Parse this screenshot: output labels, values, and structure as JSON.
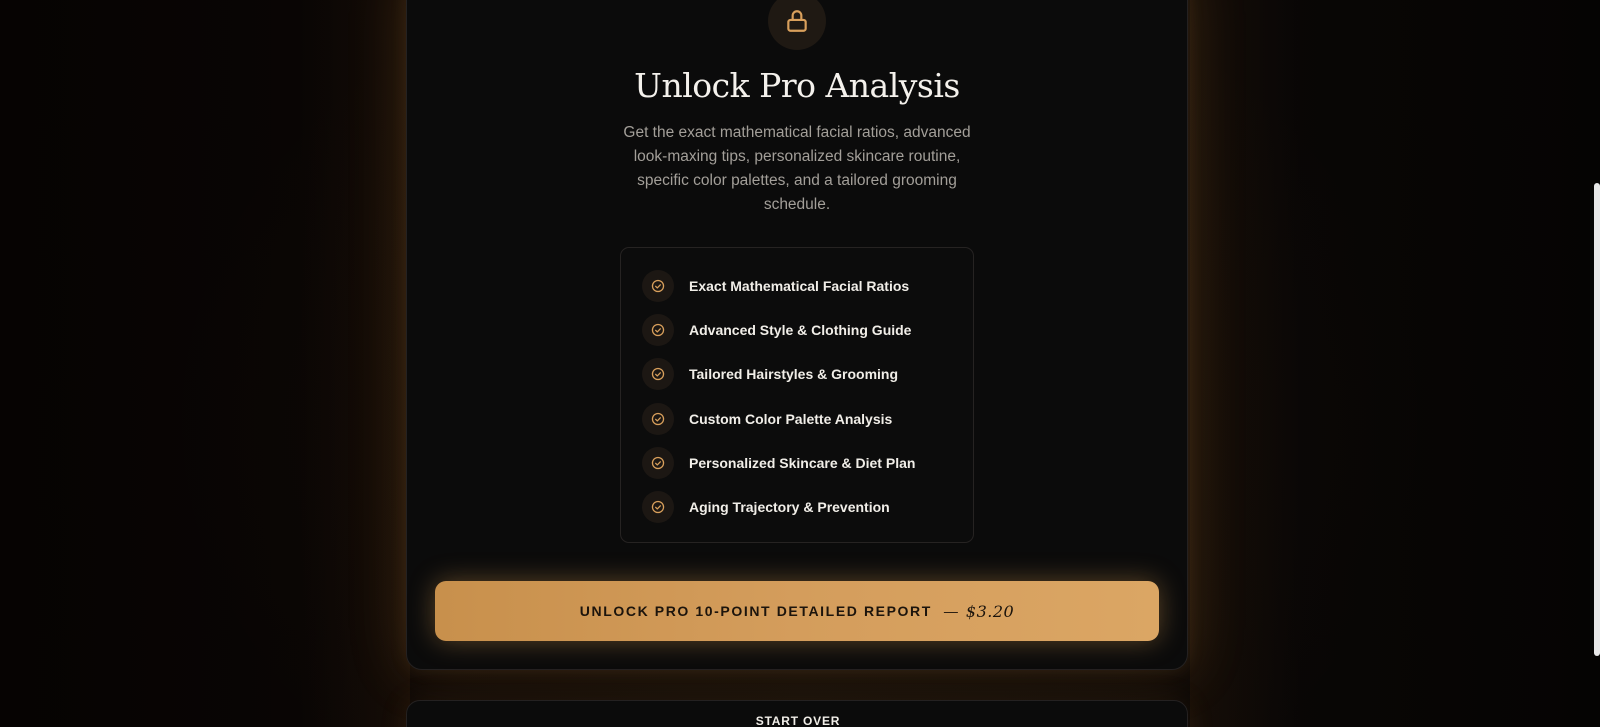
{
  "header": {
    "lock_icon": "lock-icon",
    "title": "Unlock Pro Analysis",
    "subtitle": "Get the exact mathematical facial ratios, advanced look-maxing tips, personalized skincare routine, specific color palettes, and a tailored grooming schedule."
  },
  "features": {
    "check_icon": "check-circle-icon",
    "items": [
      {
        "label": "Exact Mathematical Facial Ratios"
      },
      {
        "label": "Advanced Style & Clothing Guide"
      },
      {
        "label": "Tailored Hairstyles & Grooming"
      },
      {
        "label": "Custom Color Palette Analysis"
      },
      {
        "label": "Personalized Skincare & Diet Plan"
      },
      {
        "label": "Aging Trajectory & Prevention"
      }
    ]
  },
  "cta": {
    "label": "UNLOCK PRO 10-POINT DETAILED REPORT",
    "separator": "—",
    "price": "$3.20"
  },
  "footer": {
    "start_over_label": "START OVER"
  },
  "colors": {
    "accent": "#d49d5c",
    "background": "#0b0b0b",
    "text": "#f1eee8"
  }
}
